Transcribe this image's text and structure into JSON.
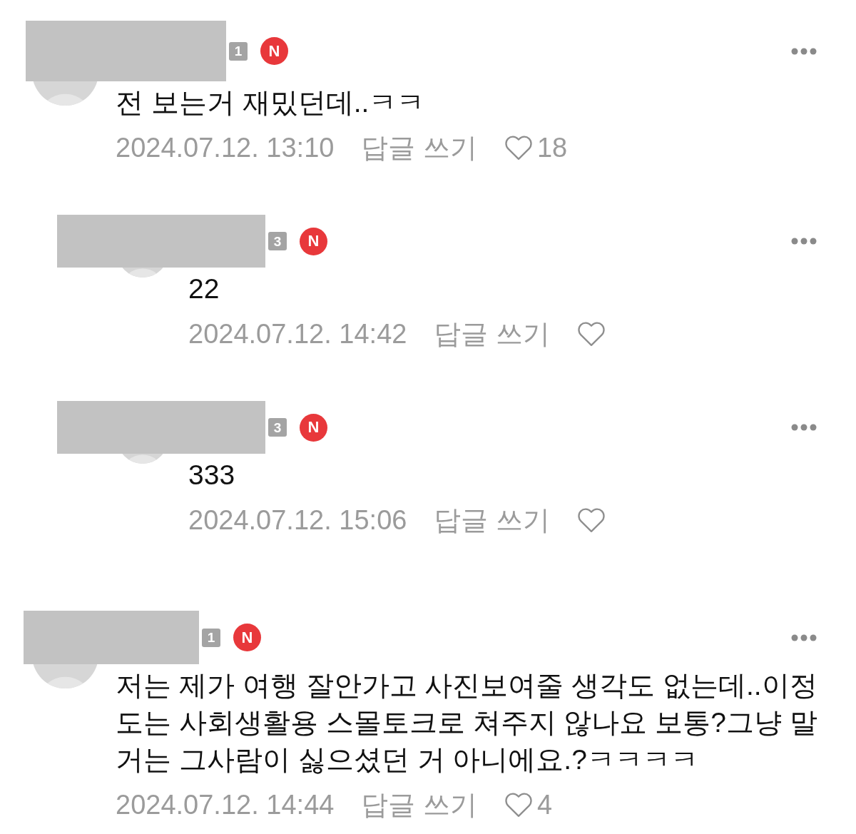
{
  "threads": [
    {
      "author_redacted": true,
      "level": "1",
      "badge": "N",
      "text": "전 보는거 재밌던데..ㅋㅋ",
      "date": "2024.07.12. 13:10",
      "reply_label": "답글 쓰기",
      "liked": false,
      "likes": "18",
      "replies": [
        {
          "author_redacted": true,
          "level": "3",
          "badge": "N",
          "text": "22",
          "date": "2024.07.12. 14:42",
          "reply_label": "답글 쓰기",
          "liked": false
        },
        {
          "author_redacted": true,
          "level": "3",
          "badge": "N",
          "text": "333",
          "date": "2024.07.12. 15:06",
          "reply_label": "답글 쓰기",
          "liked": false
        }
      ]
    },
    {
      "author_redacted": true,
      "level": "1",
      "badge": "N",
      "text": "저는 제가 여행 잘안가고 사진보여줄 생각도 없는데..이정도는 사회생활용 스몰토크로 쳐주지 않나요 보통?그냥 말거는 그사람이 싫으셨던 거 아니에요.?ㅋㅋㅋㅋ",
      "date": "2024.07.12. 14:44",
      "reply_label": "답글 쓰기",
      "liked": false,
      "likes": "4"
    }
  ]
}
